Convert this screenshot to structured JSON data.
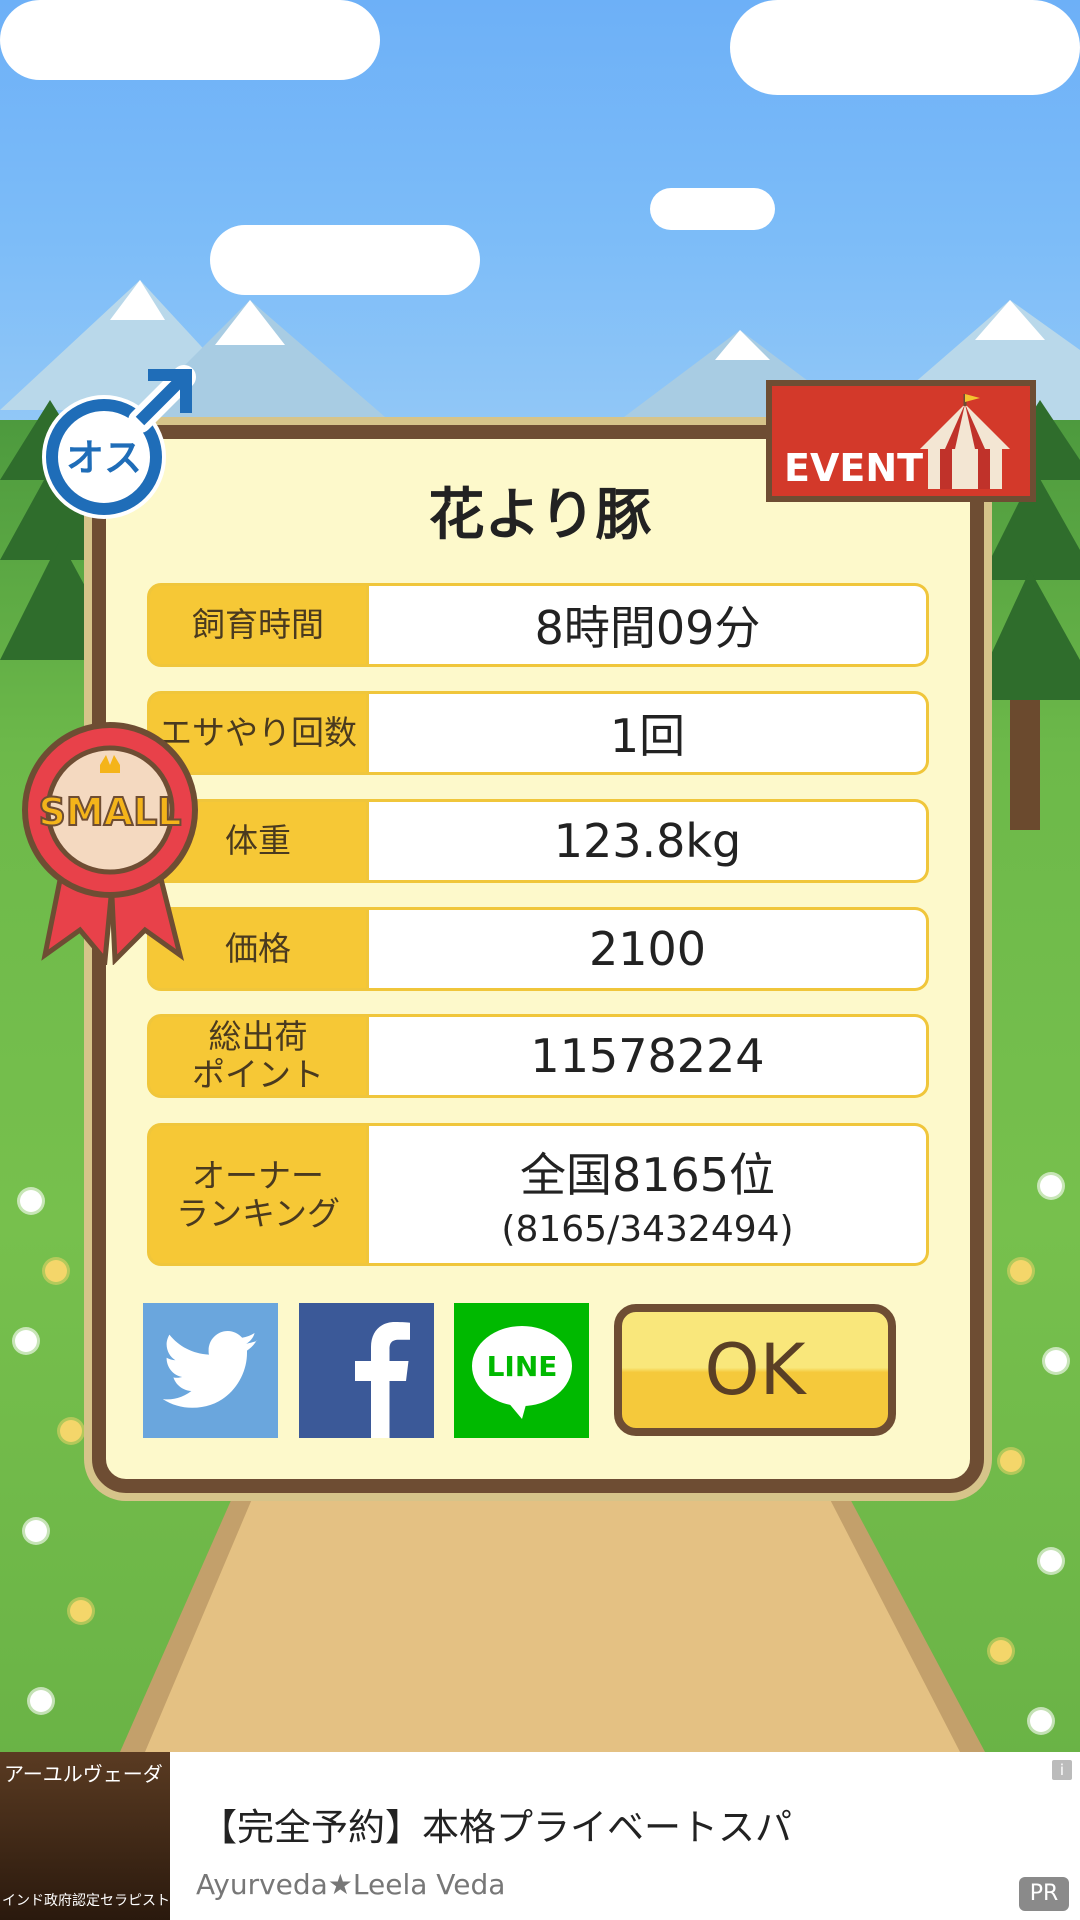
{
  "pig_name": "花より豚",
  "gender_label": "オス",
  "badge_label": "SMALL",
  "event_label": "EVENT",
  "stats": [
    {
      "label": "飼育時間",
      "value": "8時間09分"
    },
    {
      "label": "エサやり回数",
      "value": "1回"
    },
    {
      "label": "体重",
      "value": "123.8kg"
    },
    {
      "label": "価格",
      "value": "2100"
    },
    {
      "label": "総出荷\nポイント",
      "value": "11578224"
    },
    {
      "label": "オーナー\nランキング",
      "value": "全国8165位",
      "sub": "(8165/3432494)"
    }
  ],
  "share": {
    "line_label": "LINE"
  },
  "ok_label": "OK",
  "ad": {
    "thumb_top": "アーユルヴェーダ",
    "thumb_bottom": "インド政府認定セラピスト在中",
    "title": "【完全予約】本格プライベートスパ",
    "subtitle": "Ayurveda★Leela Veda",
    "pr_label": "PR",
    "info_label": "i"
  },
  "colors": {
    "panel_bg": "#fdf9cb",
    "label_bg": "#f6c836",
    "frame": "#6e4d33",
    "twitter": "#6aa6dd",
    "facebook": "#3b5998",
    "line": "#00b900",
    "event": "#d3392a"
  }
}
